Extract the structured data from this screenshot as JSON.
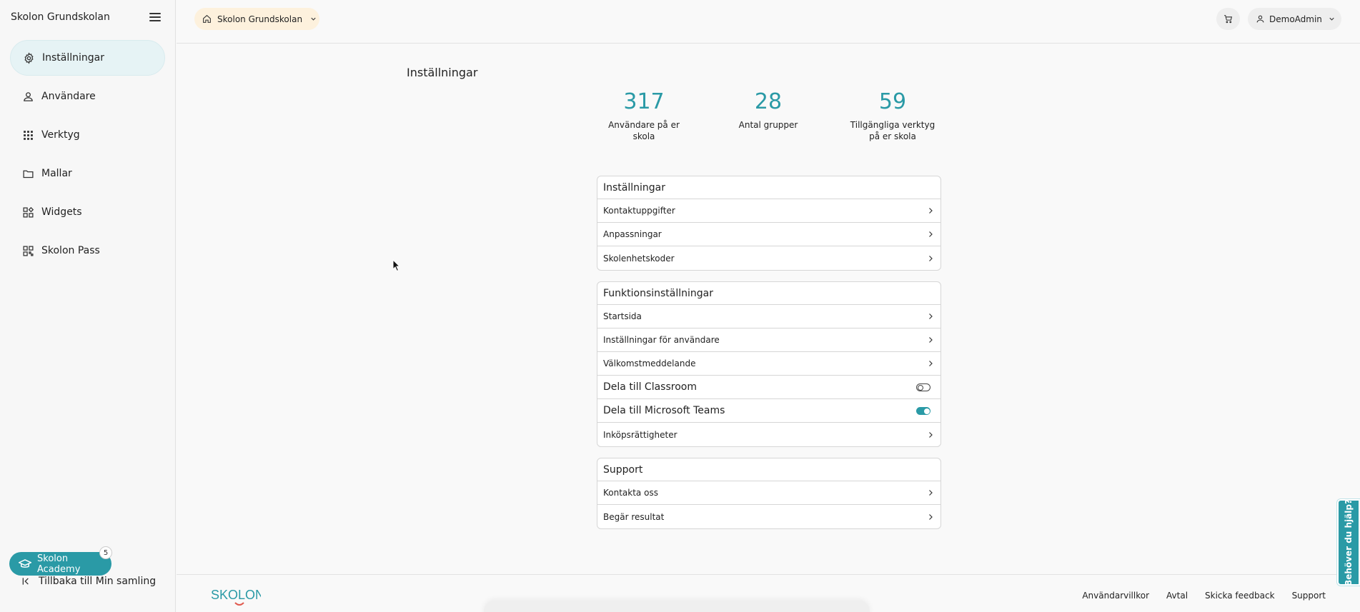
{
  "sidebar": {
    "title": "Skolon Grundskolan",
    "items": [
      {
        "label": "Inställningar",
        "icon": "gear-icon",
        "active": true
      },
      {
        "label": "Användare",
        "icon": "user-icon",
        "active": false
      },
      {
        "label": "Verktyg",
        "icon": "grid-icon",
        "active": false
      },
      {
        "label": "Mallar",
        "icon": "folder-icon",
        "active": false
      },
      {
        "label": "Widgets",
        "icon": "widgets-icon",
        "active": false
      },
      {
        "label": "Skolon Pass",
        "icon": "qr-icon",
        "active": false
      }
    ],
    "academy_label": "Skolon Academy",
    "academy_badge": "5",
    "back_label": "Tillbaka till Min samling"
  },
  "topbar": {
    "school_label": "Skolon Grundskolan",
    "user_label": "DemoAdmin"
  },
  "main": {
    "title": "Inställningar",
    "stats": [
      {
        "value": "317",
        "label": "Användare på er skola"
      },
      {
        "value": "28",
        "label": "Antal grupper"
      },
      {
        "value": "59",
        "label": "Tillgängliga verktyg på er skola"
      }
    ],
    "cards": [
      {
        "title": "Inställningar",
        "rows": [
          {
            "label": "Kontaktuppgifter",
            "kind": "link"
          },
          {
            "label": "Anpassningar",
            "kind": "link"
          },
          {
            "label": "Skolenhetskoder",
            "kind": "link"
          }
        ]
      },
      {
        "title": "Funktionsinställningar",
        "rows": [
          {
            "label": "Startsida",
            "kind": "link"
          },
          {
            "label": "Inställningar för användare",
            "kind": "link"
          },
          {
            "label": "Välkomstmeddelande",
            "kind": "link"
          },
          {
            "label": "Dela till Classroom",
            "kind": "toggle",
            "on": false
          },
          {
            "label": "Dela till Microsoft Teams",
            "kind": "toggle",
            "on": true
          },
          {
            "label": "Inköpsrättigheter",
            "kind": "link"
          }
        ]
      },
      {
        "title": "Support",
        "rows": [
          {
            "label": "Kontakta oss",
            "kind": "link"
          },
          {
            "label": "Begär resultat",
            "kind": "link"
          }
        ]
      }
    ]
  },
  "footer": {
    "logo_text": "SKOLON",
    "links": [
      "Användarvillkor",
      "Avtal",
      "Skicka feedback",
      "Support"
    ]
  },
  "help_tab": "Behöver du hjälp?",
  "colors": {
    "accent": "#2a9aa6",
    "school_pill": "#fdf1dd",
    "active_nav": "#e6f3f5"
  }
}
